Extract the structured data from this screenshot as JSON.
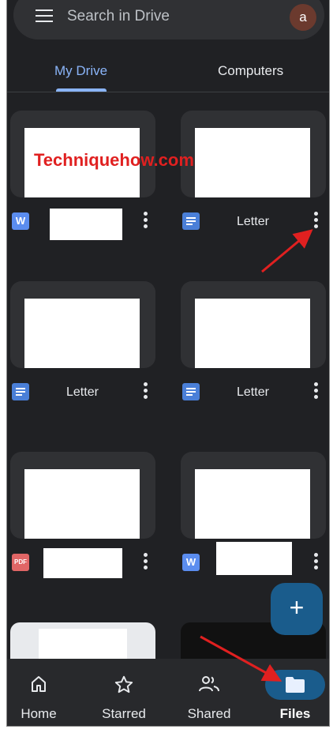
{
  "search": {
    "placeholder": "Search in Drive",
    "avatar_letter": "a"
  },
  "tabs": [
    {
      "label": "My Drive",
      "active": true
    },
    {
      "label": "Computers",
      "active": false
    }
  ],
  "watermark": "Techniquehow.com",
  "files": [
    {
      "icon": "word-icon",
      "name": ""
    },
    {
      "icon": "docs-icon",
      "name": "Letter"
    },
    {
      "icon": "docs-icon",
      "name": "Letter"
    },
    {
      "icon": "docs-icon",
      "name": "Letter"
    },
    {
      "icon": "pdf-icon",
      "name": ""
    },
    {
      "icon": "word-icon",
      "name": ""
    }
  ],
  "icon_text": {
    "word": "W",
    "pdf": "PDF"
  },
  "fab": {
    "symbol": "+"
  },
  "bottom_nav": [
    {
      "label": "Home",
      "icon": "home-icon"
    },
    {
      "label": "Starred",
      "icon": "star-icon"
    },
    {
      "label": "Shared",
      "icon": "people-icon"
    },
    {
      "label": "Files",
      "icon": "folder-icon",
      "active": true
    }
  ],
  "colors": {
    "background": "#202124",
    "accent": "#8ab4f8",
    "fab": "#1a5c8c",
    "annotation": "#e02020"
  }
}
